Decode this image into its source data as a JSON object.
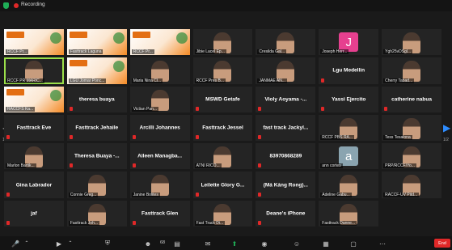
{
  "window": {
    "recording_label": "Recording"
  },
  "pager": {
    "left_page": "1/2",
    "right_page": "1/2"
  },
  "toolbar": {
    "icons": [
      "microphone-icon",
      "chevron-up-icon",
      "video-icon",
      "chevron-up-icon",
      "security-icon",
      "participants-icon",
      "chevron-up-icon",
      "polls-icon",
      "chat-icon",
      "share-screen-icon",
      "chevron-up-icon",
      "record-icon",
      "reactions-icon",
      "apps-icon",
      "whiteboard-icon",
      "more-icon"
    ],
    "participants_count": "68",
    "end_label": "End"
  },
  "tiles": [
    {
      "kind": "ppt",
      "label": "RCCF Pr..."
    },
    {
      "kind": "ppt",
      "label": "Fasttrack Laguna"
    },
    {
      "kind": "ppt",
      "label": "RCCF Pr..."
    },
    {
      "kind": "photo",
      "label": "Jibie Lacel Ep..."
    },
    {
      "kind": "photo",
      "label": "Cresilda Gal..."
    },
    {
      "kind": "avatar",
      "letter": "J",
      "color": "#e6408f",
      "label": "Joseph Herr..."
    },
    {
      "kind": "photo",
      "label": "Ygh25vDSgl..."
    },
    {
      "kind": "photo",
      "speaking": true,
      "label": "RCCF PR MARIC..."
    },
    {
      "kind": "ppt",
      "label": "LGU Jomar Ponc..."
    },
    {
      "kind": "photo",
      "label": "Maria Nina Cl..."
    },
    {
      "kind": "photo",
      "label": "RCCF Pres B..."
    },
    {
      "kind": "photo",
      "label": "JANMAE AN..."
    },
    {
      "kind": "name",
      "name": "Lgu Medellin"
    },
    {
      "kind": "photo",
      "label": "Cherry Tabad..."
    },
    {
      "kind": "ppt",
      "label": "RACCFS Ka..."
    },
    {
      "kind": "name",
      "name": "theresa buaya"
    },
    {
      "kind": "photo",
      "label": "Victian Pan..."
    },
    {
      "kind": "name",
      "name": "MSWD Getafe"
    },
    {
      "kind": "name",
      "name": "Violy Aoyama -..."
    },
    {
      "kind": "name",
      "name": "Yassi Ejercito"
    },
    {
      "kind": "name",
      "name": "catherine nabua"
    },
    {
      "kind": "name",
      "name": "Fasttrack Eve"
    },
    {
      "kind": "name",
      "name": "Fasttrack Jehaile"
    },
    {
      "kind": "name",
      "name": "Arcilli Johannes"
    },
    {
      "kind": "name",
      "name": "Fasttrack Jessel"
    },
    {
      "kind": "name",
      "name": "fast track Jackyl..."
    },
    {
      "kind": "photo",
      "label": "RCCF PBS RA..."
    },
    {
      "kind": "photo",
      "label": "Tess Tesalona"
    },
    {
      "kind": "photo",
      "label": "Marlon Bartik..."
    },
    {
      "kind": "name",
      "name": "Theresa Buaya -..."
    },
    {
      "kind": "name",
      "name": "Aileen Managba..."
    },
    {
      "kind": "photo",
      "label": "ATNI RICO..."
    },
    {
      "kind": "name",
      "name": "83970868289"
    },
    {
      "kind": "avatar",
      "letter": "a",
      "color": "#8aa4b0",
      "label": "ann cortes"
    },
    {
      "kind": "photo",
      "label": "PRP/RCCF/Yo..."
    },
    {
      "kind": "name",
      "name": "Gina Labrador"
    },
    {
      "kind": "photo",
      "label": "Connie Greg..."
    },
    {
      "kind": "photo",
      "label": "Janine Bolites"
    },
    {
      "kind": "name",
      "name": "Leilette Glory G..."
    },
    {
      "kind": "name",
      "name": "(Má Káng Rong)..."
    },
    {
      "kind": "photo",
      "label": "Adeline Gabu..."
    },
    {
      "kind": "photo",
      "label": "RACCF-UV Pitd..."
    },
    {
      "kind": "name",
      "name": "jaf"
    },
    {
      "kind": "photo",
      "label": "Fasttrack Joh..."
    },
    {
      "kind": "name",
      "name": "Fasttrack Glen"
    },
    {
      "kind": "photo",
      "label": "Fast Track Di..."
    },
    {
      "kind": "name",
      "name": "Deane's iPhone"
    },
    {
      "kind": "photo",
      "label": "Fasttrack Danne..."
    }
  ]
}
